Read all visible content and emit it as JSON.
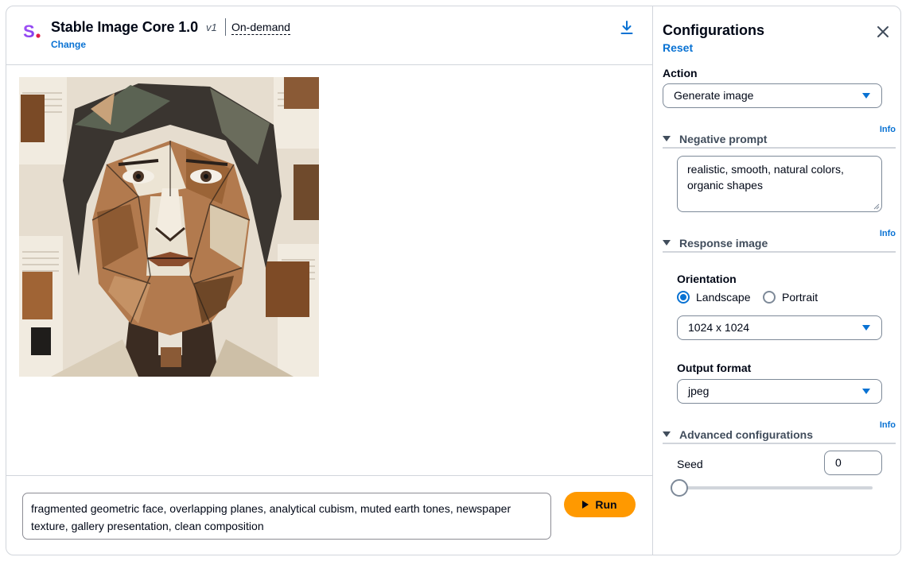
{
  "header": {
    "model_name": "Stable Image Core 1.0",
    "model_version": "v1",
    "mode": "On-demand",
    "change_label": "Change"
  },
  "prompt": {
    "text": "fragmented geometric face, overlapping planes, analytical cubism, muted earth tones, newspaper texture, gallery presentation, clean composition",
    "run_label": "Run"
  },
  "config": {
    "title": "Configurations",
    "reset_label": "Reset",
    "action_label": "Action",
    "action_value": "Generate image",
    "negative_prompt": {
      "title": "Negative prompt",
      "info": "Info",
      "value": "realistic, smooth, natural colors, organic shapes"
    },
    "response_image": {
      "title": "Response image",
      "info": "Info",
      "orientation_label": "Orientation",
      "orientation_options": [
        "Landscape",
        "Portrait"
      ],
      "orientation_selected": "Landscape",
      "size_value": "1024 x 1024",
      "output_format_label": "Output format",
      "output_format_value": "jpeg"
    },
    "advanced": {
      "title": "Advanced configurations",
      "info": "Info",
      "seed_label": "Seed",
      "seed_value": "0",
      "seed_slider_fraction": 0
    }
  },
  "colors": {
    "accent": "#0972d3",
    "run_button": "#ff9900",
    "logo_gradient": [
      "#8b5cf6",
      "#e11d48"
    ]
  },
  "icons": [
    "logo-icon",
    "download-icon",
    "play-icon",
    "close-icon",
    "caret-down-icon",
    "expand-triangle-icon",
    "resize-grip-icon"
  ]
}
